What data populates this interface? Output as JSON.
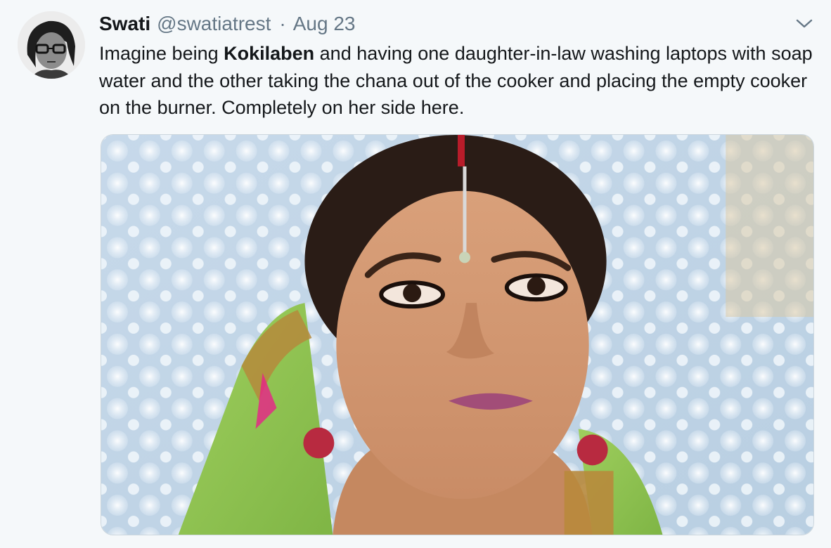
{
  "tweet": {
    "author": {
      "display_name": "Swati",
      "handle": "@swatiatrest"
    },
    "separator": "·",
    "date": "Aug 23",
    "text": {
      "part1": "Imagine being ",
      "bold": "Kokilaben",
      "part2": " and having one daughter-in-law washing laptops with soap water and the other taking the chana out of the cooker and placing the empty cooker on the burner. Completely on her side here."
    },
    "icons": {
      "menu": "chevron-down-icon"
    },
    "colors": {
      "background": "#f5f8fa",
      "secondary_text": "#657786",
      "primary_text": "#14171a"
    }
  }
}
